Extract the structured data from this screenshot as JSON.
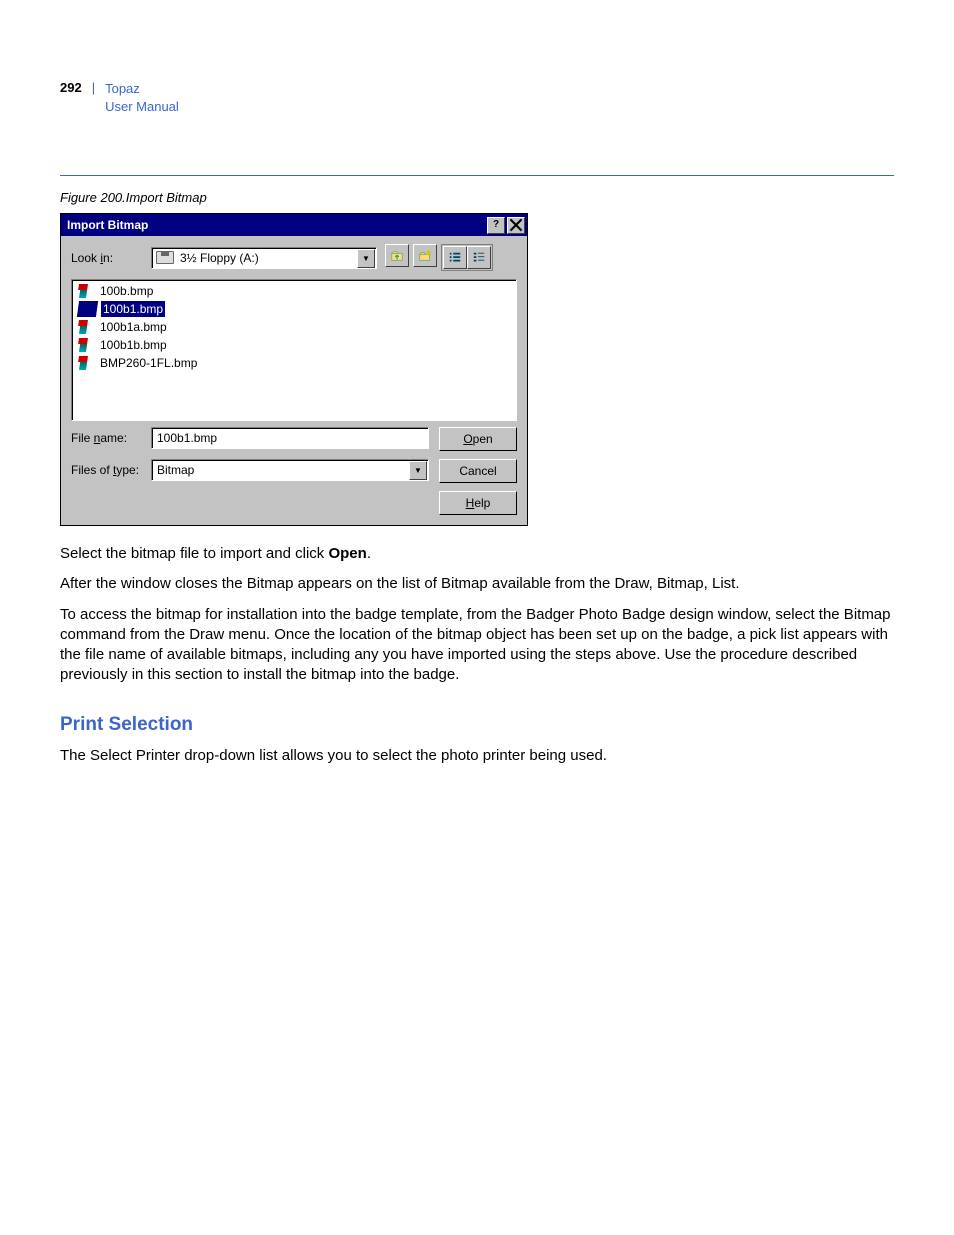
{
  "header": {
    "page_number": "292",
    "product": "Topaz",
    "subtitle": "User Manual"
  },
  "figure_caption": "Figure 200.Import Bitmap",
  "dialog": {
    "title": "Import Bitmap",
    "look_in_label": "Look in:",
    "look_in_value": "3½ Floppy (A:)",
    "files": [
      "100b.bmp",
      "100b1.bmp",
      "100b1a.bmp",
      "100b1b.bmp",
      "BMP260-1FL.bmp"
    ],
    "selected_index": 1,
    "file_name_label": "File name:",
    "file_name_value": "100b1.bmp",
    "files_of_type_label": "Files of type:",
    "files_of_type_value": "Bitmap",
    "open_btn": "Open",
    "cancel_btn": "Cancel",
    "help_btn": "Help"
  },
  "body": {
    "p1_a": "Select the bitmap file to import and click ",
    "p1_b": "Open",
    "p1_c": ".",
    "p2": "After the window closes the Bitmap appears on the list of Bitmap available from the Draw, Bitmap, List.",
    "p3": "To access the bitmap for installation into the badge template, from the Badger Photo Badge design window, select the Bitmap command from the Draw menu. Once the location of the bitmap object has been set up on the badge, a pick list appears with the file name of available bitmaps, including any you have imported using the steps above. Use the procedure described previously in this section to install the bitmap into the badge.",
    "h2": "Print Selection",
    "p4": "The Select Printer drop-down list allows you to select the photo printer being used."
  }
}
